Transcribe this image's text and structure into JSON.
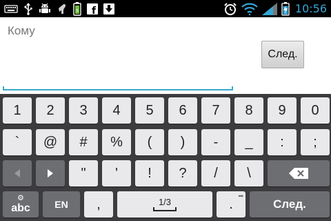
{
  "status_bar": {
    "time": "10:56",
    "left_icons": [
      "keyboard-icon",
      "usb-icon",
      "android-debug-icon",
      "android-icon",
      "battery-saver-icon",
      "facebook-icon",
      "download-icon"
    ],
    "right_icons": [
      "alarm-icon",
      "wifi-icon",
      "signal-icon",
      "battery-charging-icon"
    ],
    "time_color": "#36a6d6"
  },
  "compose": {
    "to_label": "Кому",
    "next_button_label": "След."
  },
  "keyboard": {
    "row1": [
      "1",
      "2",
      "3",
      "4",
      "5",
      "6",
      "7",
      "8",
      "9",
      "0"
    ],
    "row2": [
      "`",
      "@",
      "#",
      "%",
      "(",
      ")",
      "-",
      "_",
      ":",
      ";"
    ],
    "row3_keys": [
      "\"",
      "'",
      "!",
      "?",
      "/",
      "\\"
    ],
    "lang_key": "EN",
    "comma_key": ",",
    "page_indicator": "1/3",
    "period_key": ".",
    "abc_key": "abc",
    "next_key": "След.",
    "accent_color": "#39a9c9"
  }
}
